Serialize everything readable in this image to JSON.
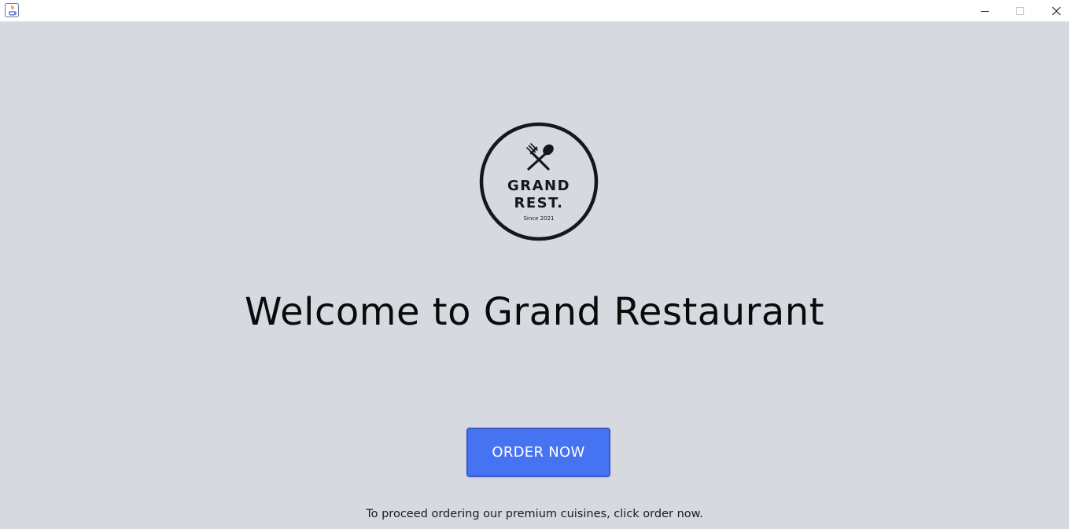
{
  "window": {
    "title": "",
    "controls": {
      "minimize_icon": "minimize-icon",
      "maximize_icon": "maximize-icon",
      "close_icon": "close-icon"
    }
  },
  "logo": {
    "line1": "GRAND",
    "line2": "REST.",
    "since": "Since 2021",
    "icon": "fork-spoon-icon"
  },
  "main": {
    "welcome": "Welcome to Grand Restaurant",
    "order_button": "ORDER NOW",
    "hint": "To proceed ordering our premium cuisines, click order now."
  },
  "colors": {
    "background": "#d7d9e1",
    "button": "#4673f2",
    "button_border": "#3a5cc4",
    "logo_ink": "#16171c"
  }
}
